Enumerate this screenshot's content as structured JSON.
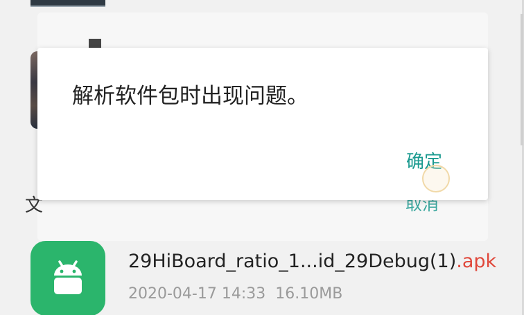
{
  "dialog": {
    "message": "解析软件包时出现问题。",
    "ok_label": "确定"
  },
  "background": {
    "partial_char": "文",
    "cancel_label": "取消"
  },
  "file": {
    "name": "29HiBoard_ratio_1...id_29Debug(1)",
    "extension": ".apk",
    "date": "2020-04-17 14:33",
    "size": "16.10MB",
    "icon": "android-icon"
  },
  "colors": {
    "accent": "#1a9a8f",
    "apk_icon_bg": "#2bb56c",
    "extension": "#e0483b"
  }
}
